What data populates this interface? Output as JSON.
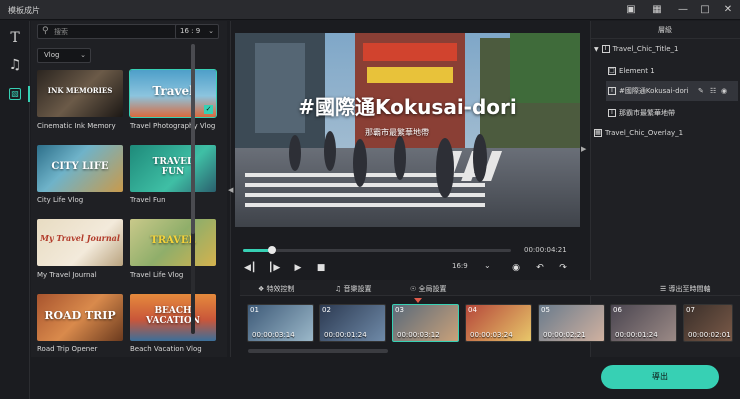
{
  "app_title": "模板成片",
  "search": {
    "placeholder": "搜索"
  },
  "ratio_filter": "16 : 9",
  "category": "Vlog",
  "templates": [
    {
      "label": "Cinematic Ink Memory",
      "overlay": "INK MEMORIES"
    },
    {
      "label": "Travel Photography Vlog",
      "overlay": "Travel"
    },
    {
      "label": "City Life Vlog",
      "overlay": "CITY LIFE"
    },
    {
      "label": "Travel Fun",
      "overlay": "TRAVEL FUN"
    },
    {
      "label": "My Travel Journal",
      "overlay": "My Travel Journal"
    },
    {
      "label": "Travel Life Vlog",
      "overlay": "TRAVEL"
    },
    {
      "label": "Road Trip Opener",
      "overlay": "ROAD TRIP"
    },
    {
      "label": "Beach Vacation Vlog",
      "overlay": "BEACH VACATION"
    }
  ],
  "video_overlay": {
    "title": "#國際通Kokusai-dori",
    "subtitle": "那霸市最繁華地帶"
  },
  "playback": {
    "time": "00:00:04:21",
    "aspect": "16:9",
    "progress_fraction": 0.11
  },
  "layers": {
    "header": "層級",
    "items": [
      {
        "label": "Travel_Chic_Title_1",
        "level": 0
      },
      {
        "label": "Element 1",
        "level": 1
      },
      {
        "label": "#國際通Kokusai-dori",
        "level": 1,
        "selected": true
      },
      {
        "label": "那霸市最繁華地帶",
        "level": 1
      },
      {
        "label": "Travel_Chic_Overlay_1",
        "level": 0
      }
    ]
  },
  "toolbar": {
    "effects": "特效控制",
    "music": "音樂設置",
    "global": "全局設置",
    "export_timeline": "導出至時間軸"
  },
  "clips": [
    {
      "num": "01",
      "time": "00:00:03:14"
    },
    {
      "num": "02",
      "time": "00:00:01:24"
    },
    {
      "num": "03",
      "time": "00:00:03:12"
    },
    {
      "num": "04",
      "time": "00:00:03:24"
    },
    {
      "num": "05",
      "time": "00:00:02:21"
    },
    {
      "num": "06",
      "time": "00:00:01:24"
    },
    {
      "num": "07",
      "time": "00:00:02:01"
    }
  ],
  "export_label": "導出",
  "colors": {
    "accent": "#37d0b4",
    "background": "#1b1c20",
    "panel": "#1f2024"
  }
}
